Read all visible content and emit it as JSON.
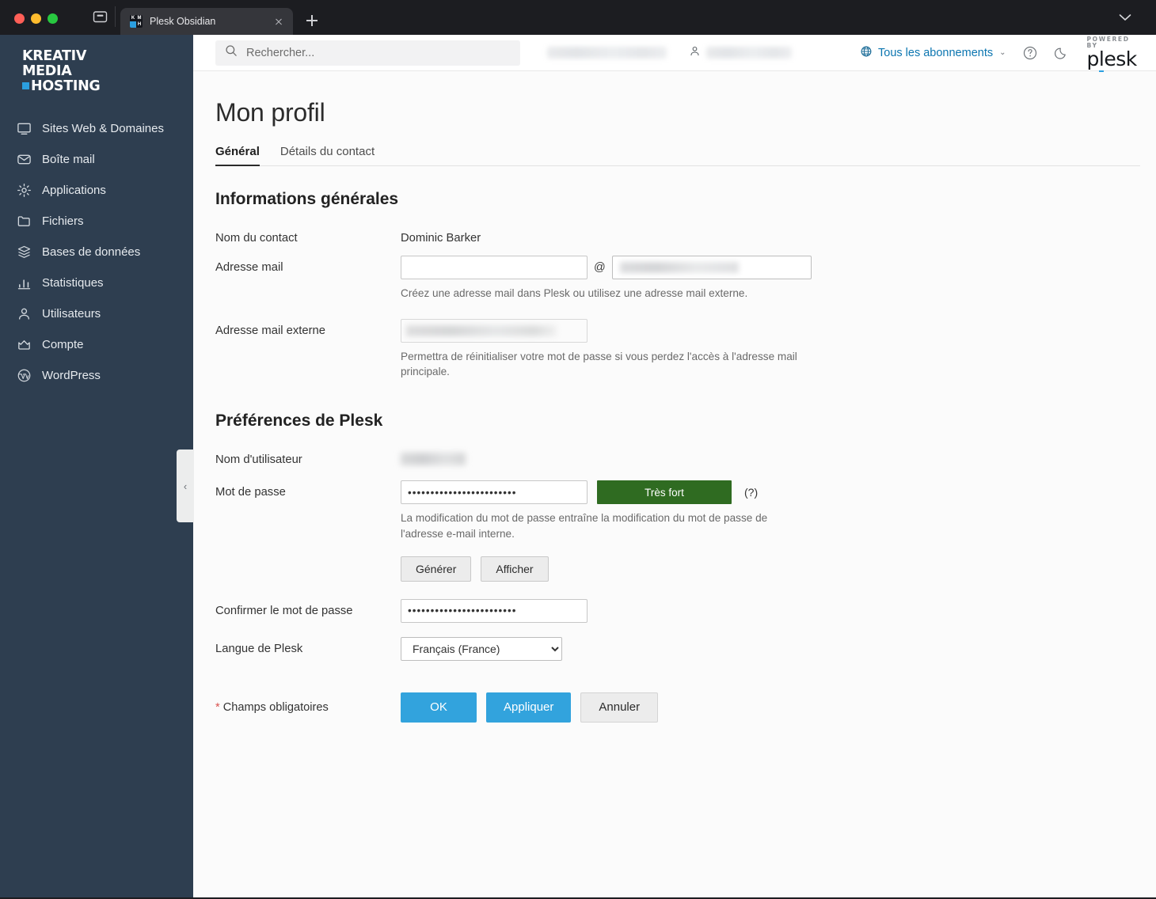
{
  "browser": {
    "tab": {
      "title": "Plesk Obsidian",
      "favicon_text": [
        "K",
        "M",
        "",
        ""
      ],
      "close_icon": "close-icon"
    },
    "new_tab_label": "+",
    "sidebar_toggle_icon": "sidebar-toggle-icon",
    "tab_list_icon": "chevron-down-icon"
  },
  "sidebar": {
    "logo": {
      "line1": "KREATIV",
      "line2": "MEDIA",
      "line3": "HOSTING"
    },
    "items": [
      {
        "label": "Sites Web & Domaines",
        "icon": "monitor-icon"
      },
      {
        "label": "Boîte mail",
        "icon": "envelope-icon"
      },
      {
        "label": "Applications",
        "icon": "gear-icon"
      },
      {
        "label": "Fichiers",
        "icon": "folder-icon"
      },
      {
        "label": "Bases de données",
        "icon": "database-icon"
      },
      {
        "label": "Statistiques",
        "icon": "bar-chart-icon"
      },
      {
        "label": "Utilisateurs",
        "icon": "user-icon"
      },
      {
        "label": "Compte",
        "icon": "crown-icon"
      },
      {
        "label": "WordPress",
        "icon": "wordpress-icon"
      }
    ],
    "collapse_handle": "‹"
  },
  "topbar": {
    "search": {
      "placeholder": "Rechercher...",
      "value": "",
      "icon": "search-icon"
    },
    "account_redacted": "",
    "user_redacted": "",
    "user_icon": "user-icon",
    "subscriptions": {
      "label": "Tous les abonnements",
      "icon": "globe-icon",
      "caret": "⌄"
    },
    "help_icon": "help-circle-icon",
    "theme_icon": "moon-icon",
    "plesk_logo": {
      "powered_by": "POWERED BY",
      "name_pre": "p",
      "name_mid": "l",
      "name_post": "esk"
    }
  },
  "page": {
    "title": "Mon profil",
    "tabs": [
      {
        "label": "Général",
        "active": true
      },
      {
        "label": "Détails du contact",
        "active": false
      }
    ]
  },
  "general_section": {
    "title": "Informations générales",
    "contact_name": {
      "label": "Nom du contact",
      "value": "Dominic Barker"
    },
    "email": {
      "label": "Adresse mail",
      "value": "",
      "at": "@",
      "domain_selected": "",
      "hint": "Créez une adresse mail dans Plesk ou utilisez une adresse mail externe."
    },
    "external_email": {
      "label": "Adresse mail externe",
      "value": "",
      "hint": "Permettra de réinitialiser votre mot de passe si vous perdez l'accès à l'adresse mail principale."
    }
  },
  "preferences_section": {
    "title": "Préférences de Plesk",
    "username": {
      "label": "Nom d'utilisateur",
      "value": ""
    },
    "password": {
      "label": "Mot de passe",
      "value": "••••••••••••••••••••••••",
      "strength": "Très fort",
      "strength_color": "#2f6b21",
      "help": "(?)",
      "hint": "La modification du mot de passe entraîne la modification du mot de passe de l'adresse e-mail interne.",
      "generate_label": "Générer",
      "show_label": "Afficher"
    },
    "confirm_password": {
      "label": "Confirmer le mot de passe",
      "value": "••••••••••••••••••••••••"
    },
    "language": {
      "label": "Langue de Plesk",
      "selected": "Français (France)"
    }
  },
  "footer_actions": {
    "required_note_star": "*",
    "required_note": " Champs obligatoires",
    "ok_label": "OK",
    "apply_label": "Appliquer",
    "cancel_label": "Annuler",
    "primary_color": "#32a3dd"
  }
}
